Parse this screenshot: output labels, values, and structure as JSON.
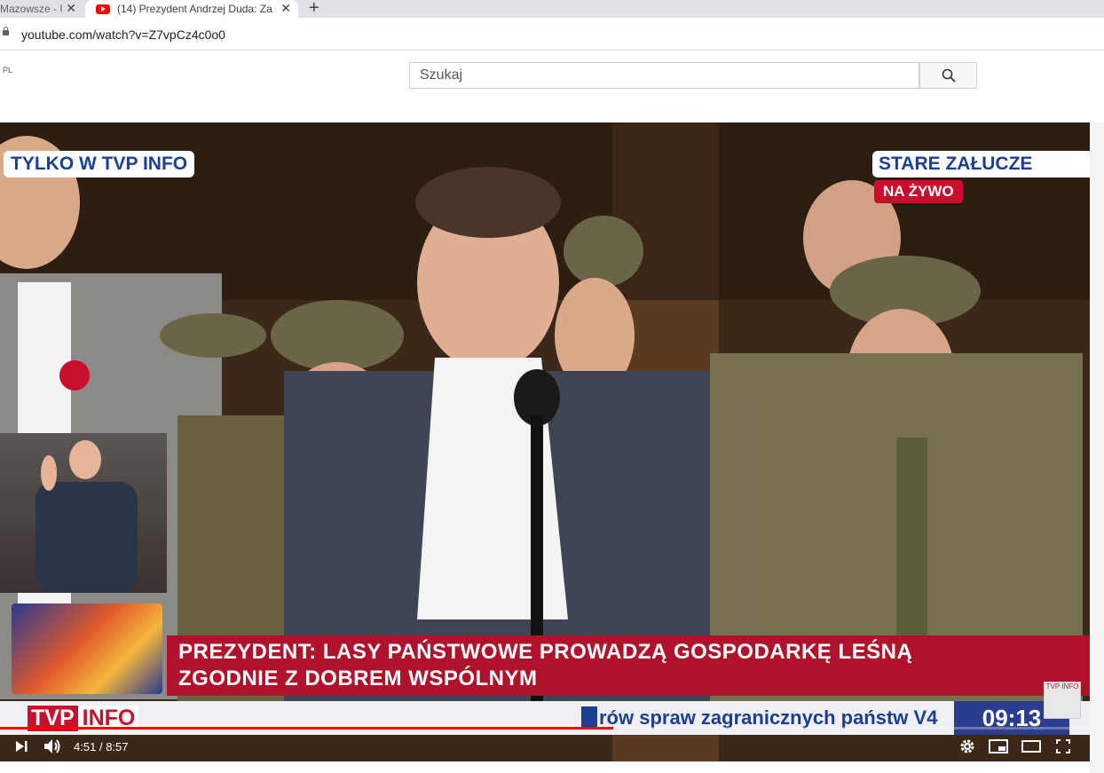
{
  "browser": {
    "tabs": [
      {
        "title": "Mazowsze - U",
        "active": false
      },
      {
        "title": "(14) Prezydent Andrzej Duda: Za",
        "active": true,
        "icon": "youtube-icon"
      }
    ],
    "new_tab_label": "+",
    "url": "youtube.com/watch?v=Z7vpCz4c0o0"
  },
  "youtube": {
    "region_label": "PL",
    "search_placeholder": "Szukaj"
  },
  "video": {
    "overlay_top_left": "TYLKO W TVP INFO",
    "overlay_location": "STARE ZAŁUCZE",
    "overlay_live": "NA ŻYWO",
    "headline_line1": "PREZYDENT: LASY PAŃSTWOWE PROWADZĄ GOSPODARKĘ LEŚNĄ",
    "headline_line2": "ZGODNIE Z DOBREM WSPÓLNYM",
    "channel_tvp": "TVP",
    "channel_info": "INFO",
    "ticker": "rów spraw zagranicznych państw V4",
    "clock": "09:13",
    "corner_logo": "TVP INFO",
    "progress": 0.5627,
    "time_current": "4:51",
    "time_separator": "/",
    "time_total": "8:57"
  },
  "colors": {
    "accent_red": "#c8102e",
    "tvp_blue": "#1c3f94",
    "yt_red": "#ff0000"
  }
}
